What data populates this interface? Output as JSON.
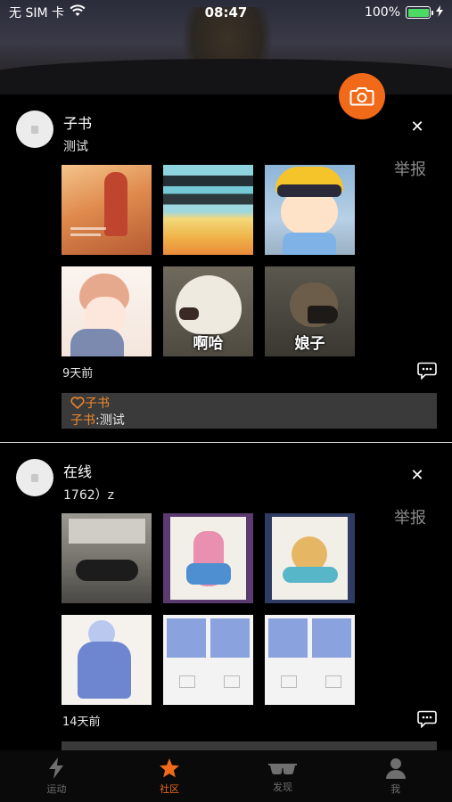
{
  "status_bar": {
    "carrier": "无 SIM 卡",
    "time": "08:47",
    "battery": "100%"
  },
  "report_label": "举报",
  "posts": [
    {
      "username": "子书",
      "text": "测试",
      "time_ago": "9天前",
      "image_captions": [
        "",
        "",
        "",
        "",
        "啊哈",
        "娘子"
      ],
      "likes": "子书",
      "comment": {
        "user": "子书",
        "text": ":测试"
      }
    },
    {
      "username": "在线",
      "text": "1762）z",
      "time_ago": "14天前",
      "image_captions": [
        "",
        "",
        "",
        "",
        "",
        ""
      ],
      "likes": "",
      "comment": {
        "user": "",
        "text": ""
      }
    }
  ],
  "tabs": [
    {
      "label": "运动",
      "icon": "lightning-icon",
      "active": false
    },
    {
      "label": "社区",
      "icon": "star-icon",
      "active": true
    },
    {
      "label": "发现",
      "icon": "sunglasses-icon",
      "active": false
    },
    {
      "label": "我",
      "icon": "person-icon",
      "active": false
    }
  ],
  "colors": {
    "accent": "#f06a1a",
    "background": "#000000",
    "battery": "#4cd964"
  }
}
